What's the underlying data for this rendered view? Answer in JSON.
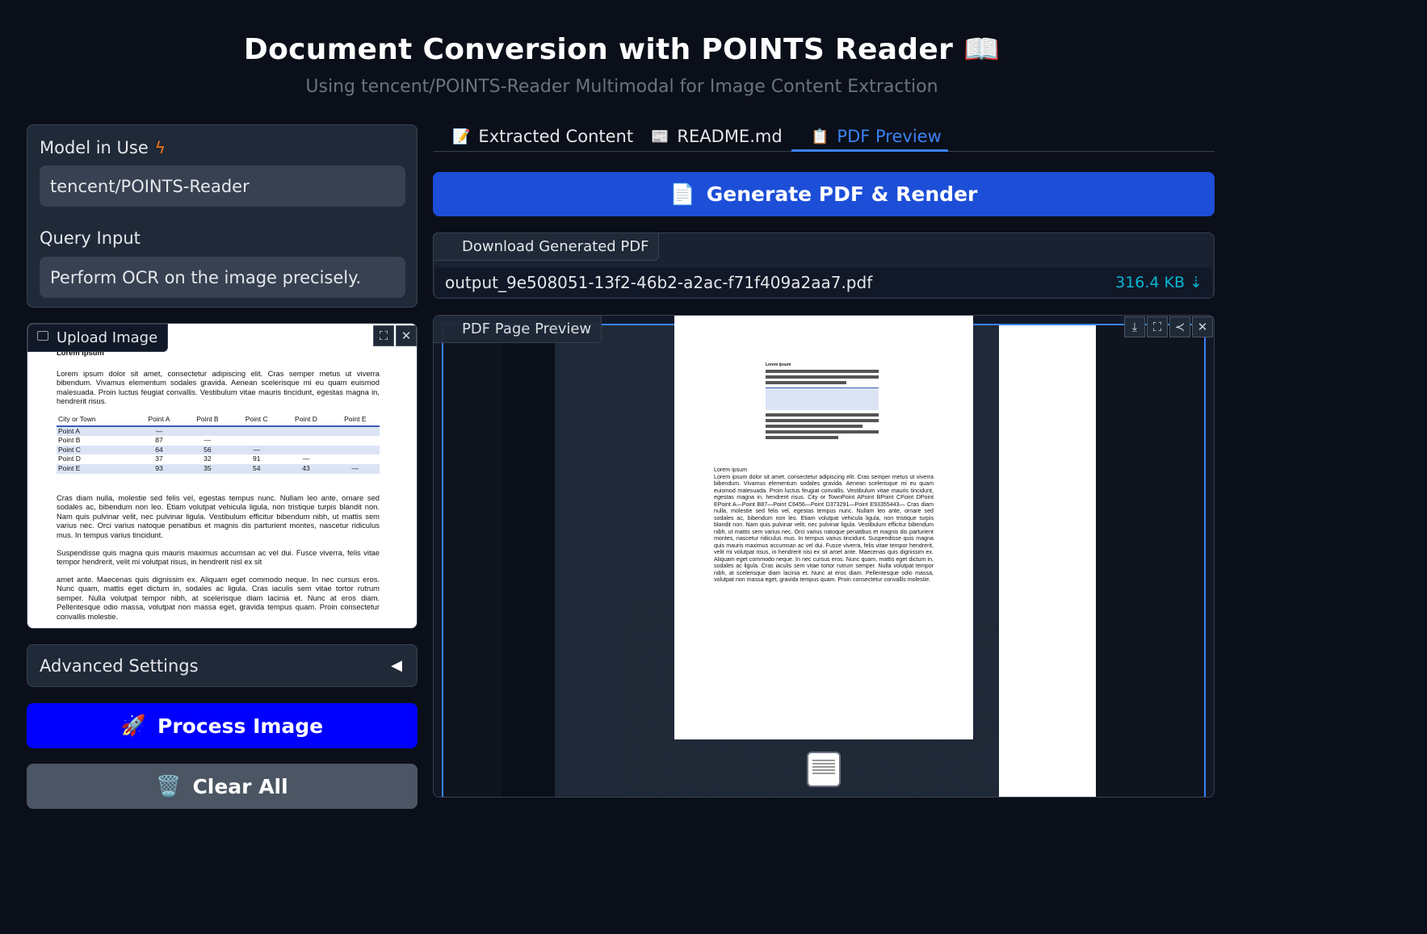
{
  "header": {
    "title": "Document Conversion with POINTS Reader 📖",
    "subtitle": "Using tencent/POINTS-Reader Multimodal for Image Content Extraction"
  },
  "left": {
    "model_label": "Model in Use",
    "model_value": "tencent/POINTS-Reader",
    "query_label": "Query Input",
    "query_value": "Perform OCR on the image precisely.",
    "upload_label": "Upload Image",
    "advanced_label": "Advanced Settings",
    "advanced_icon": "◀",
    "process_label": "Process Image",
    "process_icon": "🚀",
    "clear_label": "Clear All",
    "clear_icon": "🗑️"
  },
  "uploaded_doc": {
    "heading": "Lorem ipsum",
    "para1": "Lorem ipsum dolor sit amet, consectetur adipiscing elit. Cras semper metus ut viverra bibendum. Vivamus elementum sodales gravida. Aenean scelerisque mi eu quam euismod malesuada. Proin luctus feugiat convallis. Vestibulum vitae mauris tincidunt, egestas magna in, hendrerit risus.",
    "table_headers": [
      "City or Town",
      "Point A",
      "Point B",
      "Point C",
      "Point D",
      "Point E"
    ],
    "table_rows": [
      [
        "Point A",
        "—",
        "",
        "",
        "",
        ""
      ],
      [
        "Point B",
        "87",
        "—",
        "",
        "",
        ""
      ],
      [
        "Point C",
        "64",
        "56",
        "—",
        "",
        ""
      ],
      [
        "Point D",
        "37",
        "32",
        "91",
        "—",
        ""
      ],
      [
        "Point E",
        "93",
        "35",
        "54",
        "43",
        "—"
      ]
    ],
    "para2": "Cras diam nulla, molestie sed felis vel, egestas tempus nunc. Nullam leo ante, ornare sed sodales ac, bibendum non leo. Etiam volutpat vehicula ligula, non tristique turpis blandit non. Nam quis pulvinar velit, nec pulvinar ligula. Vestibulum efficitur bibendum nibh, ut mattis sem varius nec. Orci varius natoque penatibus et magnis dis parturient montes, nascetur ridiculus mus. In tempus varius tincidunt.",
    "para3": "Suspendisse quis magna quis mauris maximus accumsan ac vel dui. Fusce viverra, felis vitae tempor hendrerit, velit mi volutpat risus, in hendrerit nisl ex sit",
    "para4": "amet ante. Maecenas quis dignissim ex. Aliquam eget commodo neque. In nec cursus eros. Nunc quam, mattis eget dictum in, sodales ac ligula. Cras iaculis sem vitae tortor rutrum semper. Nulla volutpat tempor nibh, at scelerisque diam lacinia et. Nunc at eros diam. Pellentesque odio massa, volutpat non massa eget, gravida tempus quam. Proin consectetur convallis molestie."
  },
  "tabs": [
    {
      "icon": "📝",
      "label": "Extracted Content"
    },
    {
      "icon": "📰",
      "label": "README.md"
    },
    {
      "icon": "📋",
      "label": "PDF Preview"
    }
  ],
  "generate": {
    "icon": "📄",
    "label": "Generate PDF & Render"
  },
  "download": {
    "label": "Download Generated PDF",
    "filename": "output_9e508051-13f2-46b2-a2ac-f71f409a2aa7.pdf",
    "size": "316.4 KB ⇣"
  },
  "preview": {
    "label": "PDF Page Preview",
    "pdf_heading": "Lorem ipsum",
    "pdf_text": "Lorem ipsum dolor sit amet, consectetur adipiscing elit. Cras semper metus ut viverra bibendum. Vivamus elementum sodales gravida. Aenean scelerisque mi eu quam euismod malesuada. Proin luctus feugiat convallis. Vestibulum vitae mauris tincidunt, egestas magna in, hendrerit risus. City or TownPoint APoint BPoint CPoint DPoint EPoint A—Point B87—Point C6456—Point D373291—Point E93355443— Cras diam nulla, molestie sed felis vel, egestas tempus nunc. Nullam leo ante, ornare sed sodales ac, bibendum non leo. Etiam volutpat vehicula ligula, non tristique turpis blandit non. Nam quis pulvinar velit, nec pulvinar ligula. Vestibulum efficitur bibendum nibh, ut mattis sem varius nec. Orci varius natoque penatibus et magnis dis parturient montes, nascetur ridiculus mus. In tempus varius tincidunt. Suspendisse quis magna quis mauris maximus accumsan ac vel dui. Fusce viverra, felis vitae tempor hendrerit, velit mi volutpat risus, in hendrerit nisi ex sit amet ante. Maecenas quis dignissim ex. Aliquam eget commodo neque. In nec cursus eros. Nunc quam, mattis eget dictum in, sodales ac ligula. Cras iaculis sem vitae tortor rutrum semper. Nulla volutpat tempor nibh, at scelerisque diam lacinia et. Nunc at eros diam. Pellentesque odio massa, volutpat non massa eget, gravida tempus quam. Proin consectetur convallis molestie.",
    "bg_lines": [
      "Lorem ipsum",
      "Lorem ipsum dolor sit amet, consectetur adipiscing elit. Cras semper metus ut",
      "viverra bibendum. Vivamus elementum sodales gravida. Aenean scelerisque mi eu",
      "quam euismod malesuada. Proin luctus feugiat convallis. Vestibulum vitae mauris",
      "tincidunt, egestas magna in, hendrerit risus.",
      "City or TownPoint APoint BPoint CPoint DPoint EPoint A—Point B87—Point",
      "C6456—Point D373291—Point E93355443—",
      "Cras diam nulla, molestie sed felis vel, egestas tempus nunc. Nullam leo ante,",
      "ornare sed sodales ac, bibendum non leo. Etiam volutpat vehicula ligula, non",
      "tristique turpis blandit non. Nam quis pulvinar velit, nec pulvinar ligula. Vestibulum",
      "efficitur bibendum nibh, ut mattis sem varius nec. Orci varius natoque penatibus et",
      "magnis dis parturient montes, nascetur ridiculus mus. In tempus varius tincidunt.",
      "Suspendisse quis magna quis mauris maximus accumsan ac vel dui. Fusce",
      "viverra, felis vitae tempor hendrerit, velit mi volutpat risus, in hendrerit nisi ex sit",
      "amet ante. Maecenas quis dignissim ex. Aliquam eget commodo neque. In nec",
      "cursus eros. Nunc quam, mattis eget dictum in, sodales ac ligula. Cras iaculis sem"
    ]
  },
  "colors": {
    "background": "#0b0f19",
    "primary_button": "#1d4ed8",
    "process_button": "#0000ff",
    "clear_button": "#4b5563",
    "active_tab": "#3b82f6",
    "accent_icon": "#f97316",
    "file_size": "#06b6d4"
  },
  "icons": {
    "model_label_icon": "lightning-icon",
    "upload_icon": "image-icon",
    "fullscreen_icon": "fullscreen-icon",
    "close_icon": "close-icon",
    "download_icon": "download-icon",
    "share_icon": "share-icon"
  }
}
